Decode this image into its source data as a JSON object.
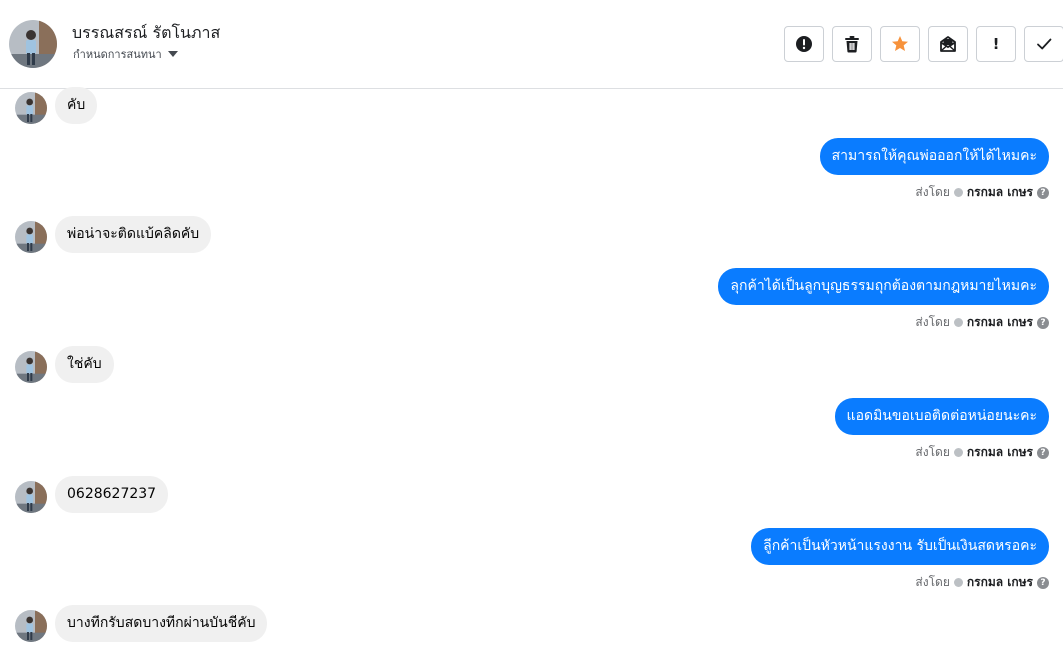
{
  "header": {
    "contact_name": "บรรณสรณ์ รัตโนภาส",
    "assign_label": "กำหนดการสนทนา",
    "toolbar": [
      {
        "name": "report-spam-button",
        "icon": "exclamation-circle-icon"
      },
      {
        "name": "delete-button",
        "icon": "trash-icon"
      },
      {
        "name": "star-button",
        "icon": "star-icon"
      },
      {
        "name": "mark-unread-button",
        "icon": "envelope-icon"
      },
      {
        "name": "follow-up-button",
        "icon": "exclamation-icon",
        "label": "!"
      },
      {
        "name": "mark-done-button",
        "icon": "checkmark-icon"
      }
    ],
    "star_color": "#f7923b"
  },
  "sent_by": {
    "prefix": "ส่งโดย",
    "agent": "กรกมล เกษร",
    "help": "?"
  },
  "messages": [
    {
      "direction": "in",
      "text": "คับ"
    },
    {
      "direction": "out",
      "text": "สามารถให้คุณพ่อออกให้ได้ไหมคะ"
    },
    {
      "direction": "in",
      "text": "พ่อน่าจะติดแบ้คลิดคับ"
    },
    {
      "direction": "out",
      "text": "ลุกค้าได้เป็นลูกบุญธรรมถุกต้องตามกฎหมายไหมคะ"
    },
    {
      "direction": "in",
      "text": "ใช่คับ"
    },
    {
      "direction": "out",
      "text": "แอดมินขอเบอติดต่อหน่อยนะคะ"
    },
    {
      "direction": "in",
      "text": "0628627237"
    },
    {
      "direction": "out",
      "text": "ลูีกค้าเป็นหัวหน้าแรงงาน  รับเป็นเงินสดหรอคะ"
    },
    {
      "direction": "in",
      "text": "บางทีกรับสดบางทีกผ่านบันชีคับ"
    }
  ],
  "colors": {
    "outgoing_bubble": "#0a7cff",
    "incoming_bubble": "#f0f0f0"
  }
}
